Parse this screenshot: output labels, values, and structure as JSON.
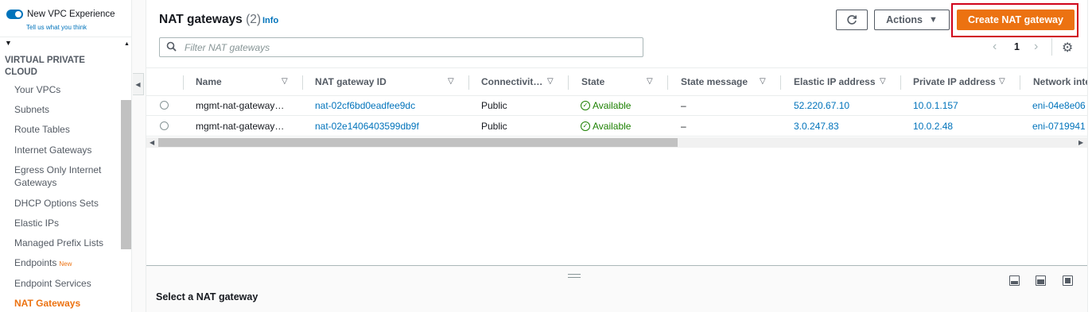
{
  "sidebar": {
    "toggle_label": "New VPC Experience",
    "feedback_link": "Tell us what you think",
    "section_title": "VIRTUAL PRIVATE CLOUD",
    "items": [
      {
        "label": "Your VPCs"
      },
      {
        "label": "Subnets"
      },
      {
        "label": "Route Tables"
      },
      {
        "label": "Internet Gateways"
      },
      {
        "label": "Egress Only Internet Gateways"
      },
      {
        "label": "DHCP Options Sets"
      },
      {
        "label": "Elastic IPs"
      },
      {
        "label": "Managed Prefix Lists"
      },
      {
        "label": "Endpoints",
        "badge": "New"
      },
      {
        "label": "Endpoint Services"
      },
      {
        "label": "NAT Gateways",
        "active": true
      }
    ]
  },
  "header": {
    "title": "NAT gateways",
    "count": "(2)",
    "info_link": "Info",
    "actions_label": "Actions",
    "create_label": "Create NAT gateway"
  },
  "filter": {
    "placeholder": "Filter NAT gateways"
  },
  "pagination": {
    "page": "1"
  },
  "table": {
    "columns": [
      "Name",
      "NAT gateway ID",
      "Connectivit…",
      "State",
      "State message",
      "Elastic IP address",
      "Private IP address",
      "Network inte"
    ],
    "rows": [
      {
        "name": "mgmt-nat-gateway…",
        "id": "nat-02cf6bd0eadfee9dc",
        "connectivity": "Public",
        "state": "Available",
        "message": "–",
        "eip": "52.220.67.10",
        "private_ip": "10.0.1.157",
        "eni": "eni-04e8e06"
      },
      {
        "name": "mgmt-nat-gateway…",
        "id": "nat-02e1406403599db9f",
        "connectivity": "Public",
        "state": "Available",
        "message": "–",
        "eip": "3.0.247.83",
        "private_ip": "10.0.2.48",
        "eni": "eni-0719941"
      }
    ]
  },
  "split_panel": {
    "title": "Select a NAT gateway"
  },
  "colors": {
    "accent": "#ec7211",
    "link": "#0073bb",
    "success": "#1d8102",
    "highlight": "#d0021b"
  }
}
